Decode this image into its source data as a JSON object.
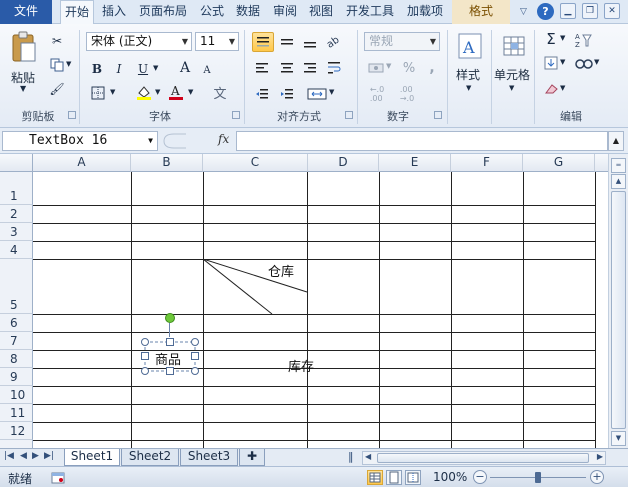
{
  "ribbon_tabs": {
    "file": "文件",
    "home": "开始",
    "insert": "插入",
    "page_layout": "页面布局",
    "formulas": "公式",
    "data": "数据",
    "review": "审阅",
    "view": "视图",
    "developer": "开发工具",
    "addins": "加载项",
    "format": "格式"
  },
  "clipboard": {
    "paste_label": "粘贴",
    "group_label": "剪贴板"
  },
  "font": {
    "font_name": "宋体 (正文)",
    "font_size": "11",
    "bold": "B",
    "italic": "I",
    "underline": "U",
    "grow": "A",
    "shrink": "A",
    "phonetic": "文",
    "group_label": "字体",
    "font_color": "#d0021b",
    "fill_color": "#ffff00"
  },
  "alignment": {
    "group_label": "对齐方式"
  },
  "number": {
    "format": "常规",
    "percent": "%",
    "comma": ",",
    "group_label": "数字"
  },
  "styles": {
    "label": "样式"
  },
  "cells": {
    "label": "单元格"
  },
  "editing": {
    "group_label": "编辑"
  },
  "formula_bar": {
    "name_box": "TextBox 16",
    "fx": "fx",
    "content": ""
  },
  "columns": [
    "A",
    "B",
    "C",
    "D",
    "E",
    "F",
    "G"
  ],
  "rows": [
    "1",
    "2",
    "3",
    "4",
    "5",
    "6",
    "7",
    "8",
    "9",
    "10",
    "11",
    "12"
  ],
  "cells_text": {
    "warehouse": "仓库",
    "product": "商品",
    "stock": "库存"
  },
  "sheets": {
    "sheet1": "Sheet1",
    "sheet2": "Sheet2",
    "sheet3": "Sheet3"
  },
  "status": {
    "ready": "就绪",
    "zoom": "100%",
    "minus": "−",
    "plus": "+"
  }
}
